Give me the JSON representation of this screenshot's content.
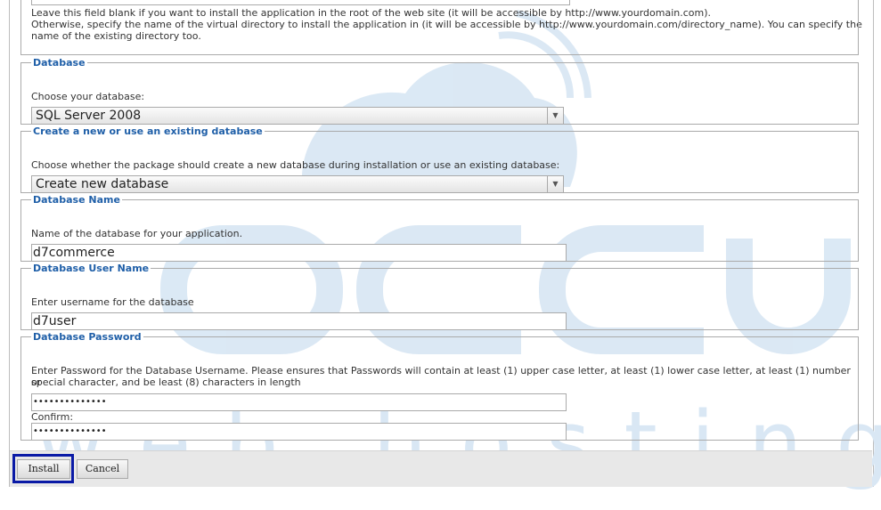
{
  "directory_help": {
    "line1": "Leave this field blank if you want to install the application in the root of the web site (it will be accessible by http://www.yourdomain.com).",
    "line2": "Otherwise, specify the name of the virtual directory to install the application in (it will be accessible by http://www.yourdomain.com/directory_name). You can specify the",
    "line3": "name of the existing directory too."
  },
  "database": {
    "legend": "Database",
    "label": "Choose your database:",
    "selected": "SQL Server 2008"
  },
  "create_db": {
    "legend": "Create a new or use an existing database",
    "label": "Choose whether the package should create a new database during installation or use an existing database:",
    "selected": "Create new database"
  },
  "db_name": {
    "legend": "Database Name",
    "label": "Name of the database for your application.",
    "value": "d7commerce"
  },
  "db_user": {
    "legend": "Database User Name",
    "label": "Enter username for the database",
    "value": "d7user"
  },
  "db_password": {
    "legend": "Database Password",
    "label_line1": "Enter Password for the Database Username. Please ensures that Passwords will contain at least (1) upper case letter, at least (1) lower case letter, at least (1) number or",
    "label_line2": "special character, and be least (8) characters in length",
    "value": "••••••••••••••",
    "confirm_label": "Confirm:",
    "confirm_value": "••••••••••••••"
  },
  "buttons": {
    "install": "Install",
    "cancel": "Cancel"
  },
  "watermark": {
    "brand": "accu",
    "tagline": "w e b   h o s t i n g"
  },
  "colors": {
    "legend": "#1f5fa8",
    "highlight": "#0a1aa6",
    "watermark": "#9bbfe0"
  }
}
